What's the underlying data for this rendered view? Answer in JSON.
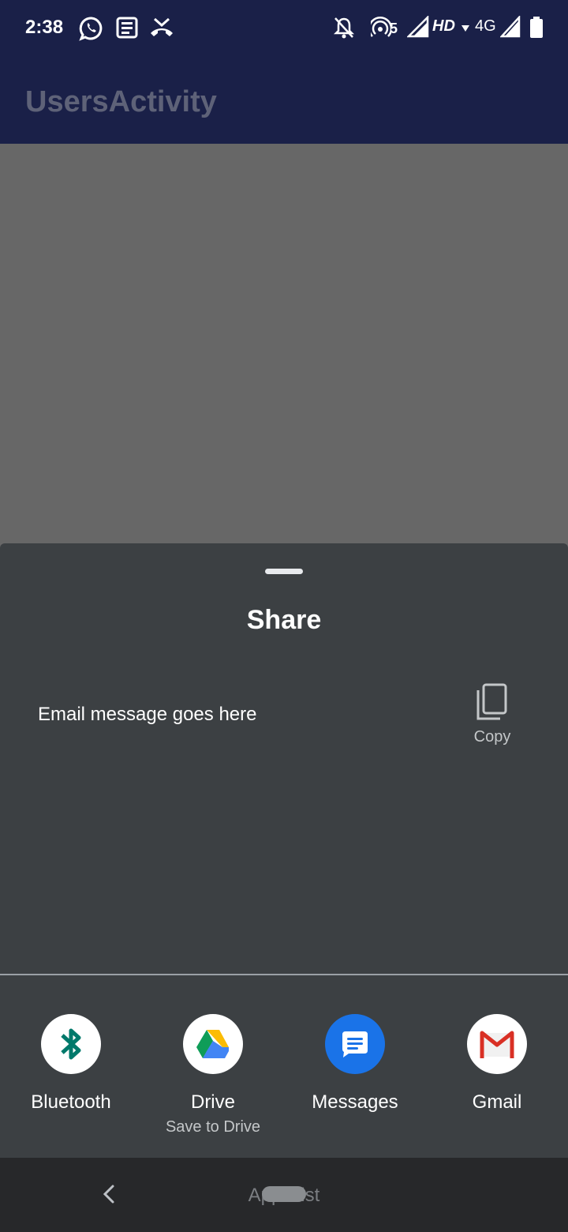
{
  "status_bar": {
    "time": "2:38",
    "network_badge": "5",
    "hd_label": "HD",
    "network_type": "4G",
    "icons": [
      "whatsapp-icon",
      "news-icon",
      "missed-call-icon",
      "notifications-off-icon",
      "hotspot-icon",
      "signal-icon",
      "data-arrow-icon",
      "signal-icon",
      "battery-icon"
    ]
  },
  "app_bar": {
    "title": "UsersActivity"
  },
  "share_sheet": {
    "title": "Share",
    "preview_text": "Email message goes here",
    "copy_label": "Copy",
    "targets": [
      {
        "label": "Bluetooth",
        "sublabel": "",
        "icon": "bluetooth-icon"
      },
      {
        "label": "Drive",
        "sublabel": "Save to Drive",
        "icon": "drive-icon"
      },
      {
        "label": "Messages",
        "sublabel": "",
        "icon": "messages-icon"
      },
      {
        "label": "Gmail",
        "sublabel": "",
        "icon": "gmail-icon"
      }
    ]
  },
  "nav_bar": {
    "hint": "Apps list"
  },
  "colors": {
    "status_bar_bg": "#1a2048",
    "sheet_bg": "#3c4043",
    "scrim": "#676767",
    "bluetooth": "#00796b",
    "messages": "#1a73e8",
    "gmail_red": "#d93025"
  }
}
